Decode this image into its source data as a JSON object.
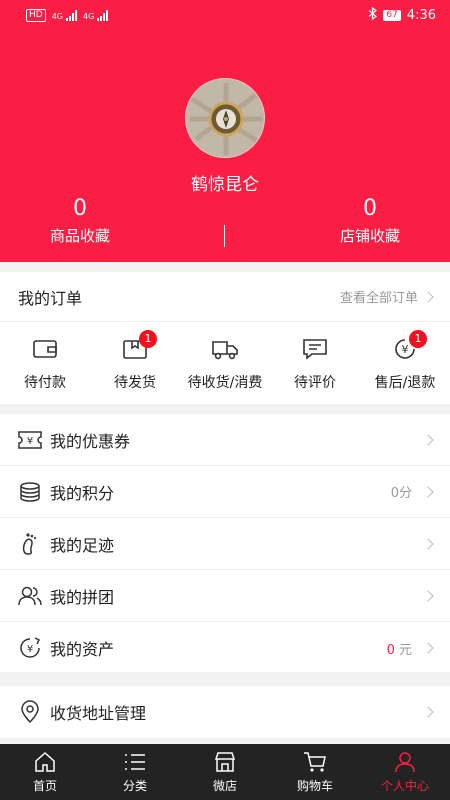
{
  "status_bar": {
    "left_chip": "HD",
    "signal_text_1": "4G",
    "signal_text_2": "4G",
    "battery": "67",
    "time": "4:36"
  },
  "profile": {
    "username": "鹤惊昆仑",
    "stats": [
      {
        "count": "0",
        "label": "商品收藏"
      },
      {
        "count": "0",
        "label": "店铺收藏"
      }
    ]
  },
  "orders": {
    "title": "我的订单",
    "view_all": "查看全部订单",
    "items": [
      {
        "label": "待付款",
        "icon": "wallet-icon",
        "badge": ""
      },
      {
        "label": "待发货",
        "icon": "package-icon",
        "badge": "1"
      },
      {
        "label": "待收货/消费",
        "icon": "truck-icon",
        "badge": ""
      },
      {
        "label": "待评价",
        "icon": "comment-icon",
        "badge": ""
      },
      {
        "label": "售后/退款",
        "icon": "refund-icon",
        "badge": "1"
      }
    ]
  },
  "menu": [
    {
      "label": "我的优惠券",
      "icon": "coupon-icon",
      "value": "",
      "unit": ""
    },
    {
      "label": "我的积分",
      "icon": "coins-icon",
      "value": "0分",
      "unit": ""
    },
    {
      "label": "我的足迹",
      "icon": "footprint-icon",
      "value": "",
      "unit": ""
    },
    {
      "label": "我的拼团",
      "icon": "group-icon",
      "value": "",
      "unit": ""
    },
    {
      "label": "我的资产",
      "icon": "assets-icon",
      "value": "0",
      "unit": "元"
    }
  ],
  "address": {
    "label": "收货地址管理",
    "icon": "location-icon"
  },
  "tabbar": [
    {
      "label": "首页",
      "icon": "home-icon",
      "active": false
    },
    {
      "label": "分类",
      "icon": "list-icon",
      "active": false
    },
    {
      "label": "微店",
      "icon": "store-icon",
      "active": false
    },
    {
      "label": "购物车",
      "icon": "cart-icon",
      "active": false
    },
    {
      "label": "个人中心",
      "icon": "user-icon",
      "active": true
    }
  ],
  "colors": {
    "brand": "#fb1e44",
    "tabbar_bg": "#232323",
    "badge": "#f2111f"
  }
}
